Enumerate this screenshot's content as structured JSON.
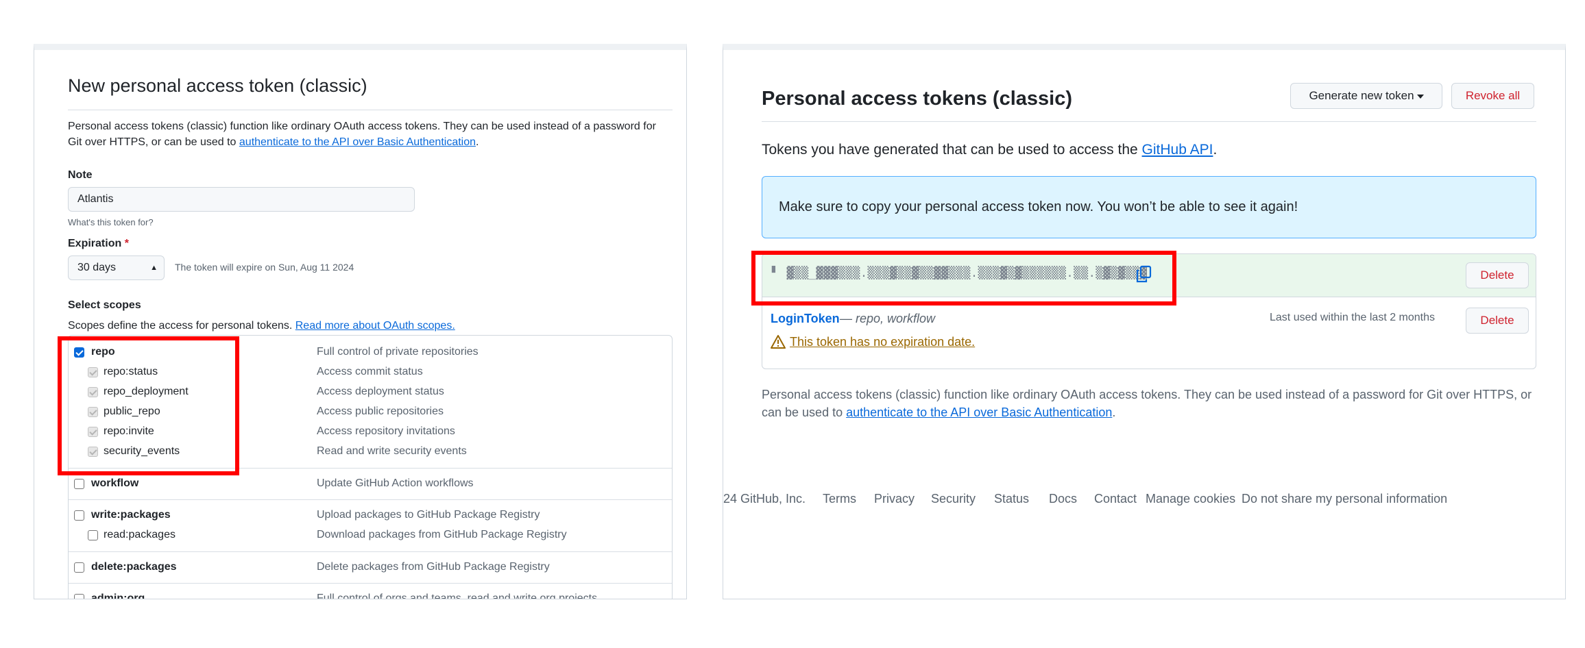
{
  "left": {
    "title": "New personal access token (classic)",
    "desc_prefix": "Personal access tokens (classic) function like ordinary OAuth access tokens. They can be used instead of a password for Git over HTTPS, or can be used to ",
    "desc_link": "authenticate to the API over Basic Authentication",
    "desc_suffix": ".",
    "note_label": "Note",
    "note_value": "Atlantis",
    "note_hint": "What's this token for?",
    "expiration_label": "Expiration",
    "expiration_required": "*",
    "expiration_value": "30 days",
    "expiration_note": "The token will expire on Sun, Aug 11 2024",
    "scopes_label": "Select scopes",
    "scopes_desc_prefix": "Scopes define the access for personal tokens. ",
    "scopes_desc_link": "Read more about OAuth scopes.",
    "scopes": [
      {
        "name": "repo",
        "desc": "Full control of private repositories",
        "state": "checked",
        "sub": false
      },
      {
        "name": "repo:status",
        "desc": "Access commit status",
        "state": "disabled",
        "sub": true
      },
      {
        "name": "repo_deployment",
        "desc": "Access deployment status",
        "state": "disabled",
        "sub": true
      },
      {
        "name": "public_repo",
        "desc": "Access public repositories",
        "state": "disabled",
        "sub": true
      },
      {
        "name": "repo:invite",
        "desc": "Access repository invitations",
        "state": "disabled",
        "sub": true
      },
      {
        "name": "security_events",
        "desc": "Read and write security events",
        "state": "disabled",
        "sub": true
      },
      {
        "name": "workflow",
        "desc": "Update GitHub Action workflows",
        "state": "unchecked",
        "sub": false
      },
      {
        "name": "write:packages",
        "desc": "Upload packages to GitHub Package Registry",
        "state": "unchecked",
        "sub": false
      },
      {
        "name": "read:packages",
        "desc": "Download packages from GitHub Package Registry",
        "state": "unchecked",
        "sub": true
      },
      {
        "name": "delete:packages",
        "desc": "Delete packages from GitHub Package Registry",
        "state": "unchecked",
        "sub": false
      },
      {
        "name": "admin:org",
        "desc": "Full control of orgs and teams, read and write org projects",
        "state": "unchecked",
        "sub": false
      }
    ]
  },
  "right": {
    "title": "Personal access tokens (classic)",
    "generate_button": "Generate new token",
    "revoke_button": "Revoke all",
    "intro_prefix": "Tokens you have generated that can be used to access the ",
    "intro_link": "GitHub API",
    "intro_suffix": ".",
    "flash": "Make sure to copy your personal access token now. You won’t be able to see it again!",
    "new_token_masked": "▘ ▓▒▒_▓▓▓▒▒▒.▒▒▒▓▒▒▓▒▒▓▓▒▒▒.▒▒▒▓▒▓▒▒▒▒▒▒.▒▒.▒▓▒▓▒▒▓",
    "delete_button": "Delete",
    "token_name": "LoginToken",
    "token_scopes": "— repo, workflow",
    "token_last_used": "Last used within the last 2 months",
    "token_warning": "This token has no expiration date.",
    "footer_desc_prefix": "Personal access tokens (classic) function like ordinary OAuth access tokens. They can be used instead of a password for Git over HTTPS, or can be used to ",
    "footer_desc_link": "authenticate to the API over Basic Authentication",
    "footer_desc_suffix": ".",
    "footer_links": [
      "24 GitHub, Inc.",
      "Terms",
      "Privacy",
      "Security",
      "Status",
      "Docs",
      "Contact",
      "Manage cookies",
      "Do not share my personal information"
    ]
  },
  "colors": {
    "link": "#0969da",
    "danger": "#cf222e",
    "highlight": "#ff0000",
    "flash_bg": "#ddf4ff",
    "new_token_bg": "#e9f7ec",
    "warning": "#9a6700"
  }
}
